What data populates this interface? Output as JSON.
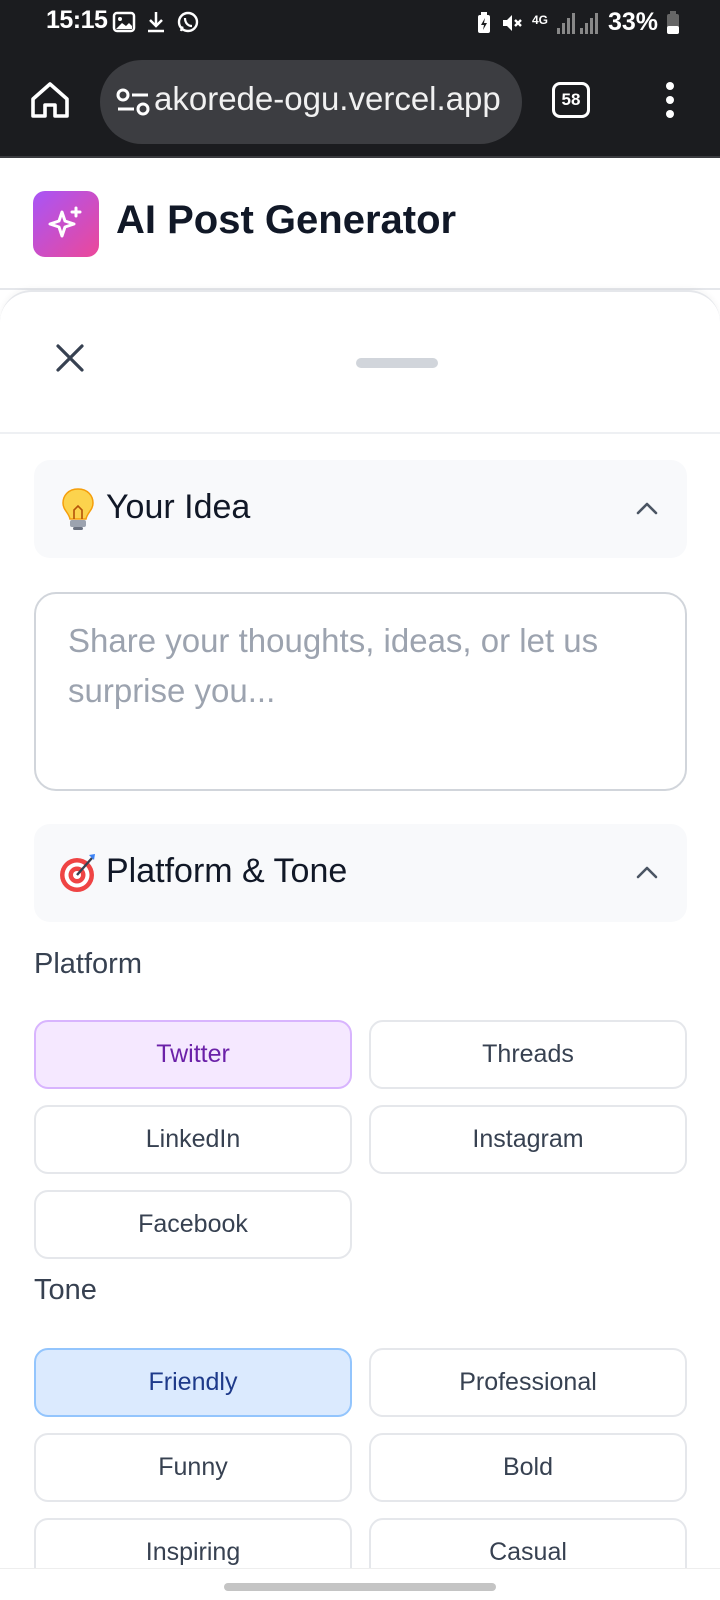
{
  "status_bar": {
    "time": "15:15",
    "network": "4G",
    "battery": "33%"
  },
  "browser": {
    "url": "akorede-ogu.vercel.app",
    "tab_count": "58"
  },
  "app": {
    "title": "AI Post Generator"
  },
  "sections": {
    "idea": {
      "title": "Your Idea",
      "emoji": "lightbulb-icon",
      "placeholder": "Share your thoughts, ideas, or let us surprise you...",
      "value": ""
    },
    "platform_tone": {
      "title": "Platform & Tone",
      "emoji": "target-icon"
    }
  },
  "platform": {
    "label": "Platform",
    "selected": "Twitter",
    "options": [
      "Twitter",
      "Threads",
      "LinkedIn",
      "Instagram",
      "Facebook"
    ]
  },
  "tone": {
    "label": "Tone",
    "selected": "Friendly",
    "options": [
      "Friendly",
      "Professional",
      "Funny",
      "Bold",
      "Inspiring",
      "Casual"
    ]
  },
  "colors": {
    "platform_selected_bg": "#f5e8ff",
    "tone_selected_bg": "#dbeafe",
    "logo_gradient_start": "#a855f7",
    "logo_gradient_end": "#ec4899"
  }
}
